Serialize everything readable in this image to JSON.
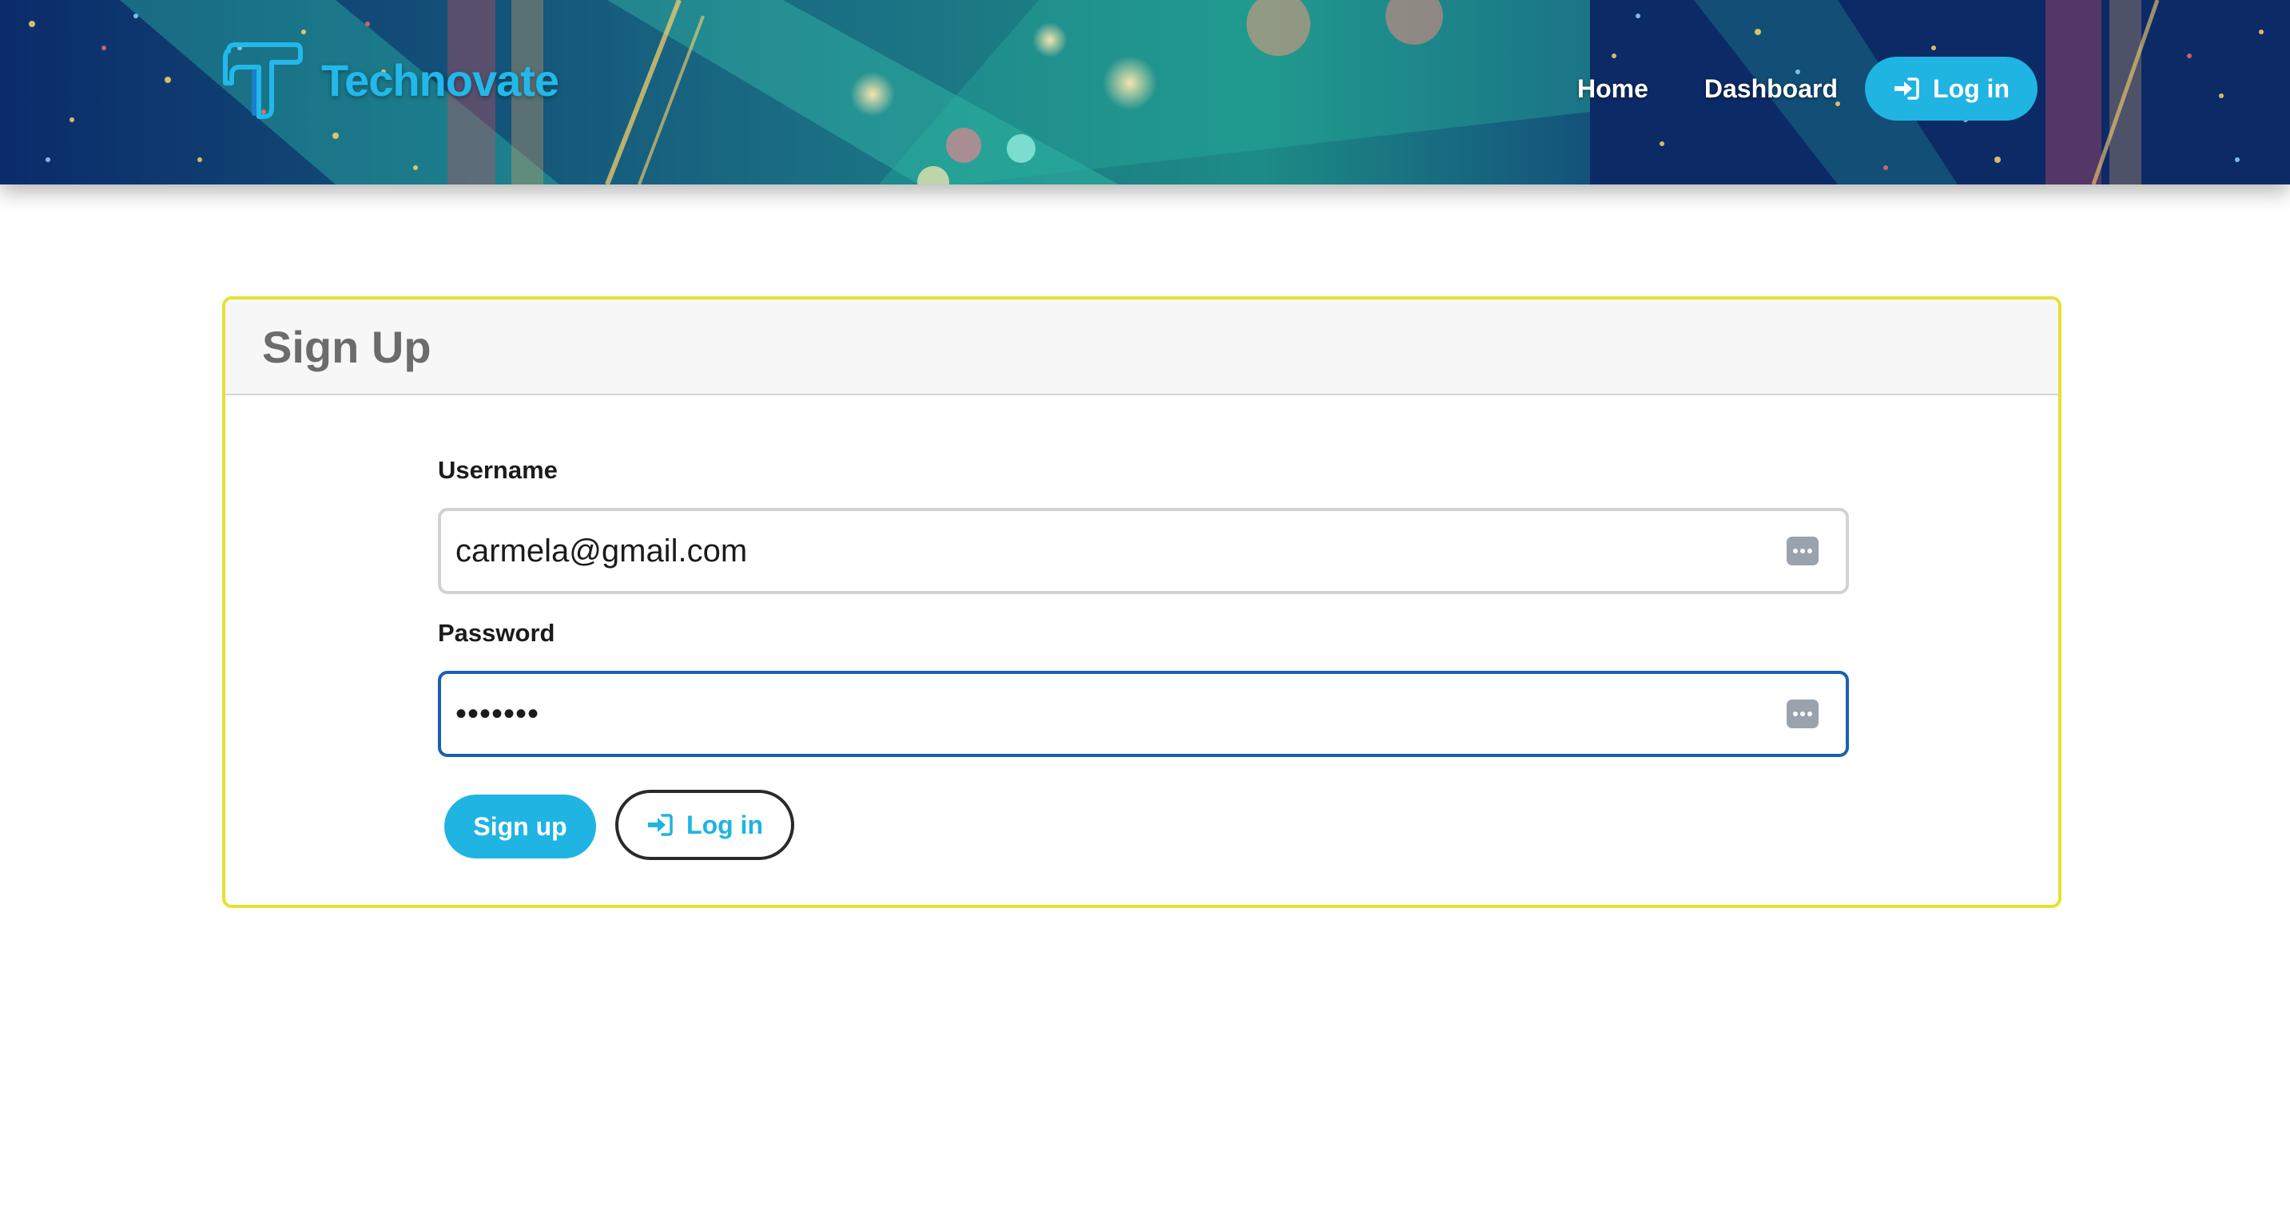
{
  "brand": {
    "name": "Technovate",
    "logo_icon": "t-logo-icon",
    "color": "#22b8ea"
  },
  "nav": {
    "links": [
      "Home",
      "Dashboard"
    ],
    "login_label": "Log in",
    "login_icon": "sign-in-icon",
    "accent": "#1fb4e2"
  },
  "card": {
    "title": "Sign Up",
    "border_color": "#e4e133"
  },
  "form": {
    "username": {
      "label": "Username",
      "value": "carmela@gmail.com",
      "icon": "keychain-autofill-icon"
    },
    "password": {
      "label": "Password",
      "value": "•••••••",
      "icon": "keychain-autofill-icon",
      "focused": true
    },
    "signup_label": "Sign up",
    "login_label": "Log in",
    "login_icon": "sign-in-icon"
  }
}
